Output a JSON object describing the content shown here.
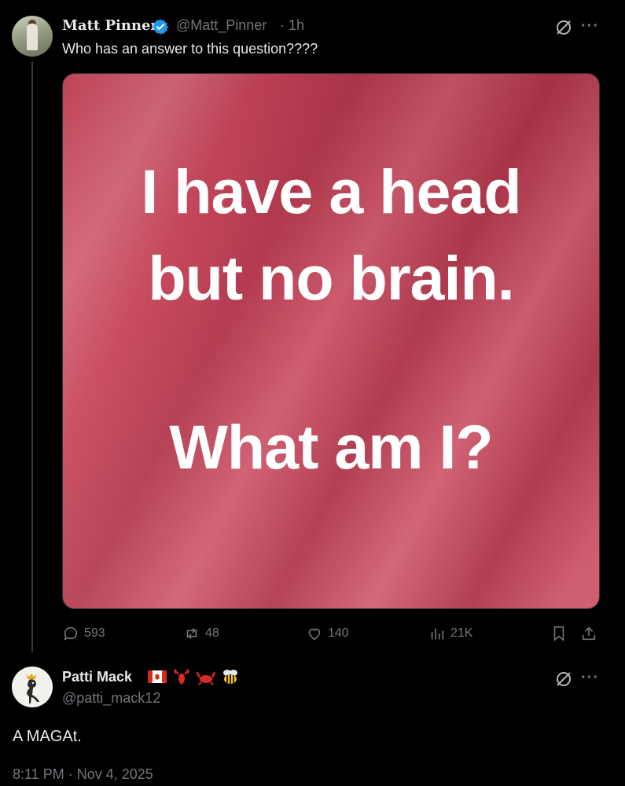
{
  "post": {
    "author_name": "Matt Pinner",
    "handle": "@Matt_Pinner",
    "age": "· 1h",
    "text": "Who has an answer to this question????",
    "image_text": {
      "line1": "I have a head",
      "line2": "but no brain.",
      "line3": "What am I?"
    },
    "stats": {
      "replies": "593",
      "reposts": "48",
      "likes": "140",
      "views": "21K"
    },
    "more": "···"
  },
  "reply": {
    "author_name": "Patti Mack",
    "handle": "@patti_mack12",
    "text": "A MAGAt.",
    "timestamp": "8:11 PM · Nov 4, 2025",
    "more": "···",
    "name_emojis": [
      "canada-flag",
      "lobster",
      "crab",
      "bee"
    ]
  },
  "colors": {
    "background": "#000000",
    "text": "#e7e9ea",
    "muted": "#71767b",
    "verified": "#1d9bf0",
    "image_pink": "#c84a5e"
  }
}
